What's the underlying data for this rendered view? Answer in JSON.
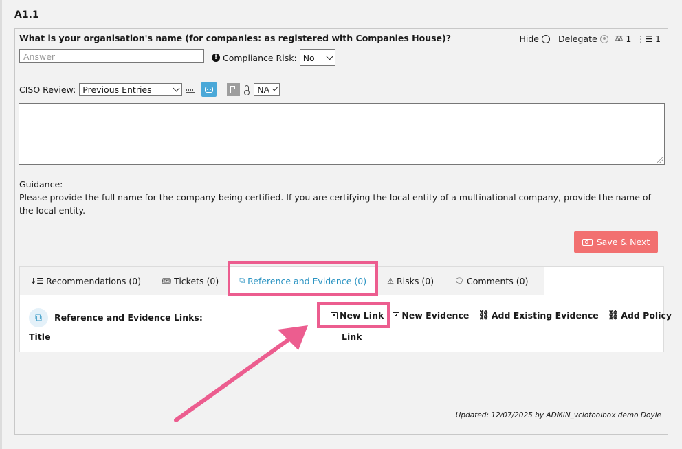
{
  "section_id": "A1.1",
  "question": {
    "text": "What is your organisation's name (for companies: as registered with Companies House)?",
    "answer_value": "",
    "answer_placeholder": "Answer"
  },
  "top_controls": {
    "hide_label": "Hide",
    "delegate_label": "Delegate",
    "scale_count": "1",
    "list_count": "1"
  },
  "compliance": {
    "label": "Compliance Risk:",
    "value": "No",
    "warn_glyph": "!"
  },
  "ciso": {
    "label": "CISO Review:",
    "entries_value": "Previous Entries",
    "na_value": "NA"
  },
  "guidance": {
    "heading": "Guidance:",
    "text": "Please provide the full name for the company being certified. If you are certifying the local entity of a multinational company, provide the name of the local entity."
  },
  "save_button": {
    "label": "Save & Next"
  },
  "tabs": [
    {
      "label": "Recommendations (0)",
      "icon": "sort-icon",
      "glyph": "↓☰"
    },
    {
      "label": "Tickets (0)",
      "icon": "ticket-icon",
      "glyph": "🎟"
    },
    {
      "label": "Reference and Evidence (0)",
      "icon": "external-link-icon",
      "glyph": "⧉",
      "active": true
    },
    {
      "label": "Risks (0)",
      "icon": "warning-icon",
      "glyph": "⚠"
    },
    {
      "label": "Comments (0)",
      "icon": "comments-icon",
      "glyph": "🗨"
    }
  ],
  "references": {
    "title": "Reference and Evidence Links:",
    "actions": {
      "new_link": "New Link",
      "new_evidence": "New Evidence",
      "add_existing": "Add Existing Evidence",
      "add_policy": "Add Policy"
    },
    "columns": {
      "title": "Title",
      "link": "Link"
    }
  },
  "updated_text": "Updated: 12/07/2025 by ADMIN_vciotoolbox demo Doyle",
  "colors": {
    "accent": "#2a93c2",
    "save": "#f27070",
    "highlight": "#ec5d8f",
    "robot": "#4aa8d8"
  }
}
